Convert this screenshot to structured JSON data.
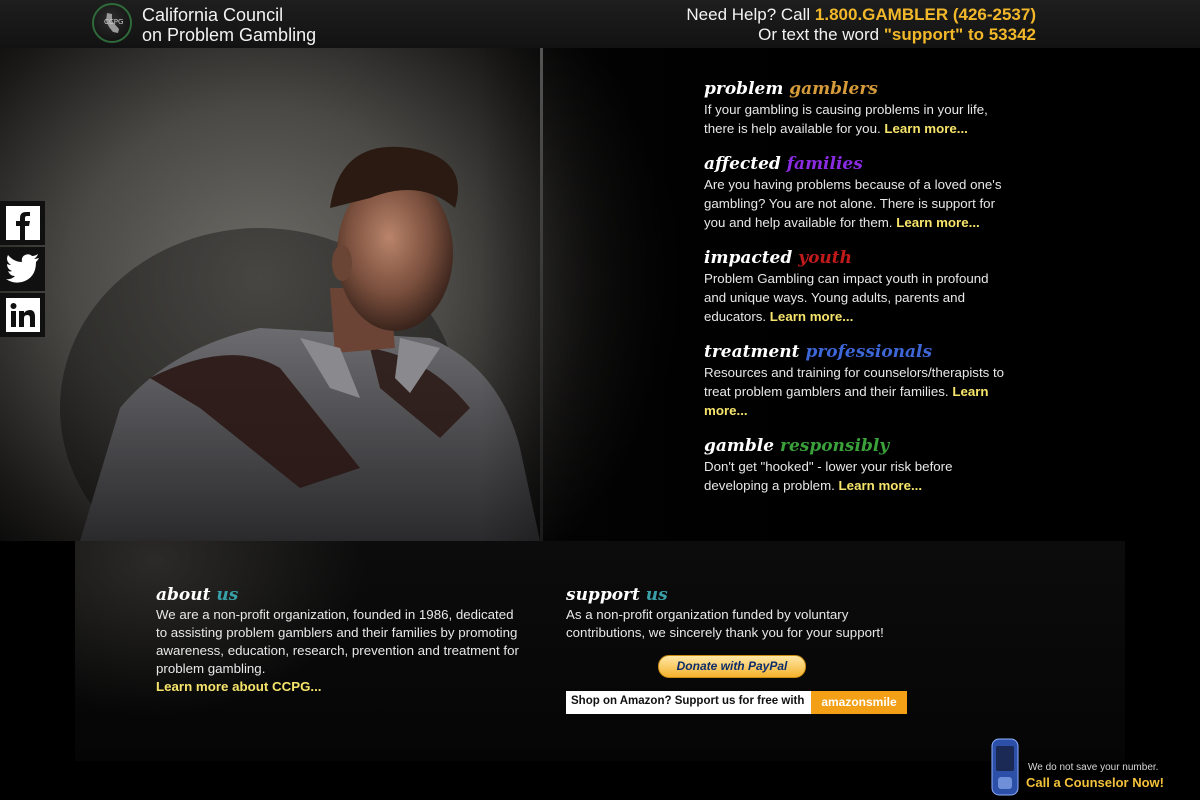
{
  "header": {
    "org_line1": "California Council",
    "org_line2": "on Problem Gambling",
    "logo_text": "CCPG",
    "help_prefix": "Need Help? Call ",
    "help_phone": "1.800.GAMBLER (426-2537)",
    "text_prefix": "Or text the word ",
    "text_code": "\"support\" to 53342"
  },
  "sections": [
    {
      "word1": "problem",
      "word2": "gamblers",
      "color": "#d59a3a",
      "text": "If your gambling is causing problems in your life, there is help available for you.",
      "link": "Learn more..."
    },
    {
      "word1": "affected",
      "word2": "families",
      "color": "#8a2be2",
      "text": "Are you having problems because of a loved one's gambling? You are not alone. There is support for you and help available for them.",
      "link": "Learn more..."
    },
    {
      "word1": "impacted",
      "word2": "youth",
      "color": "#c11a1a",
      "text": "Problem Gambling can impact youth in profound and unique ways. Young adults, parents and educators.",
      "link": "Learn more..."
    },
    {
      "word1": "treatment",
      "word2": "professionals",
      "color": "#3d66d6",
      "text": "Resources and training for counselors/therapists to treat problem gamblers and their families.",
      "link": "Learn more..."
    },
    {
      "word1": "gamble",
      "word2": "responsibly",
      "color": "#3aa13a",
      "text": "Don't get \"hooked\" - lower your risk before developing a problem.",
      "link": "Learn more..."
    }
  ],
  "social": [
    {
      "name": "facebook-icon",
      "glyph": "f"
    },
    {
      "name": "twitter-icon",
      "glyph": ""
    },
    {
      "name": "linkedin-icon",
      "glyph": "in"
    }
  ],
  "about": {
    "word1": "about",
    "word2": "us",
    "color": "#3aa0a8",
    "text": "We are a non-profit organization, founded in 1986, dedicated to assisting problem gamblers and their families by promoting awareness, education, research, prevention and treatment for problem gambling.",
    "link": "Learn more about CCPG..."
  },
  "support": {
    "word1": "support",
    "word2": "us",
    "color": "#3aa0a8",
    "text": "As a non-profit organization funded by voluntary contributions, we sincerely thank you for your support!",
    "paypal_label": "Donate with PayPal",
    "amazon_text": "Shop on Amazon? Support us for free with",
    "amazon_badge": "amazonsmile"
  },
  "counselor": {
    "no_save": "We do not save your number.",
    "call": "Call a Counselor Now!"
  }
}
